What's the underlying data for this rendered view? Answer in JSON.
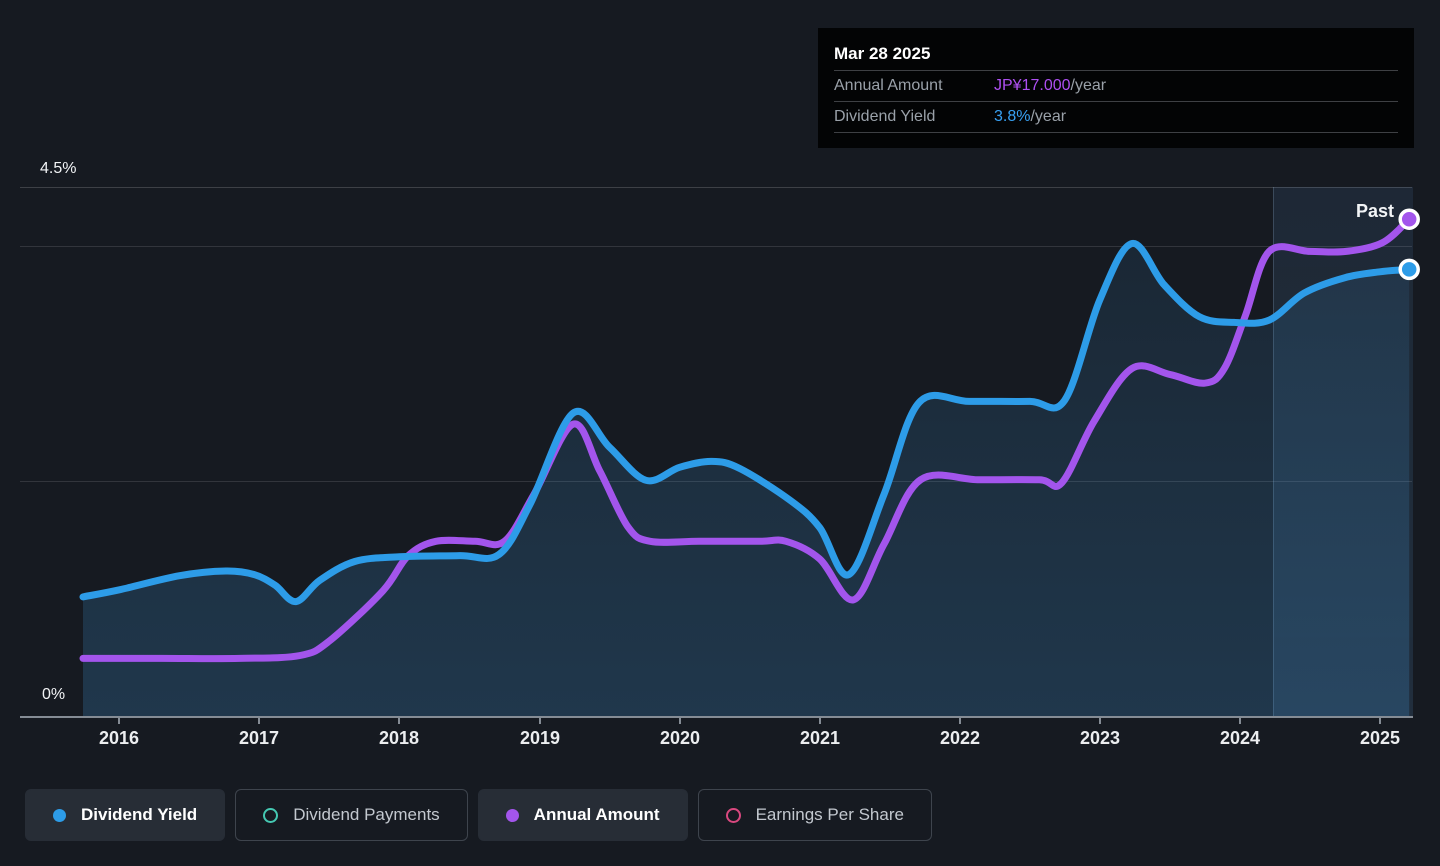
{
  "tooltip": {
    "date": "Mar 28 2025",
    "rows": [
      {
        "label": "Annual Amount",
        "value": "JP¥17.000",
        "suffix": "/year",
        "color": "#ae4ff2"
      },
      {
        "label": "Dividend Yield",
        "value": "3.8%",
        "suffix": "/year",
        "color": "#38a0f2"
      }
    ]
  },
  "chart": {
    "y_top_label": "4.5%",
    "y_bottom_label": "0%",
    "past_label": "Past",
    "x_ticks": [
      "2016",
      "2017",
      "2018",
      "2019",
      "2020",
      "2021",
      "2022",
      "2023",
      "2024",
      "2025"
    ]
  },
  "legend": [
    {
      "label": "Dividend Yield",
      "marker": "filled",
      "color": "#2d9ce8",
      "active": true
    },
    {
      "label": "Dividend Payments",
      "marker": "ring",
      "color": "#45c8b2",
      "active": false
    },
    {
      "label": "Annual Amount",
      "marker": "filled",
      "color": "#a355ec",
      "active": true
    },
    {
      "label": "Earnings Per Share",
      "marker": "ring",
      "color": "#d9487f",
      "active": false
    }
  ],
  "chart_data": {
    "type": "line",
    "x_range": [
      2015.74,
      2025.23
    ],
    "x_tick_years": [
      2016,
      2017,
      2018,
      2019,
      2020,
      2021,
      2022,
      2023,
      2024,
      2025
    ],
    "y_axis_percent": {
      "range": [
        0,
        4.5
      ],
      "labeled_ticks": [
        "4.5%",
        "0%"
      ]
    },
    "y_axis_amount_range": [
      0,
      18.1
    ],
    "gridlines_percent": [
      4.5,
      4.0,
      2.0
    ],
    "past_band_start_year": 2024.24,
    "legend_position": "bottom",
    "grid": true,
    "series": [
      {
        "name": "Dividend Yield",
        "unit": "%",
        "axis": "percent",
        "color": "#2d9ce8",
        "end_value_label": "3.8%/year",
        "points": [
          [
            2015.74,
            1.02
          ],
          [
            2016.0,
            1.08
          ],
          [
            2016.43,
            1.2
          ],
          [
            2016.76,
            1.24
          ],
          [
            2016.96,
            1.21
          ],
          [
            2017.11,
            1.12
          ],
          [
            2017.26,
            0.98
          ],
          [
            2017.43,
            1.16
          ],
          [
            2017.68,
            1.32
          ],
          [
            2018.0,
            1.36
          ],
          [
            2018.43,
            1.37
          ],
          [
            2018.71,
            1.38
          ],
          [
            2018.93,
            1.8
          ],
          [
            2019.24,
            2.58
          ],
          [
            2019.5,
            2.29
          ],
          [
            2019.76,
            2.01
          ],
          [
            2020.0,
            2.12
          ],
          [
            2020.23,
            2.17
          ],
          [
            2020.43,
            2.11
          ],
          [
            2020.79,
            1.84
          ],
          [
            2021.0,
            1.61
          ],
          [
            2021.21,
            1.21
          ],
          [
            2021.46,
            1.89
          ],
          [
            2021.71,
            2.67
          ],
          [
            2022.07,
            2.68
          ],
          [
            2022.5,
            2.68
          ],
          [
            2022.75,
            2.69
          ],
          [
            2023.0,
            3.54
          ],
          [
            2023.23,
            4.02
          ],
          [
            2023.46,
            3.67
          ],
          [
            2023.71,
            3.4
          ],
          [
            2023.96,
            3.35
          ],
          [
            2024.21,
            3.37
          ],
          [
            2024.46,
            3.6
          ],
          [
            2024.75,
            3.73
          ],
          [
            2025.0,
            3.78
          ],
          [
            2025.21,
            3.8
          ]
        ]
      },
      {
        "name": "Annual Amount",
        "unit": "JP¥",
        "axis": "amount",
        "color": "#a355ec",
        "end_value_label": "JP¥17.000/year",
        "points": [
          [
            2015.74,
            2.0
          ],
          [
            2016.3,
            2.0
          ],
          [
            2016.86,
            2.0
          ],
          [
            2017.29,
            2.1
          ],
          [
            2017.5,
            2.6
          ],
          [
            2017.88,
            4.3
          ],
          [
            2018.06,
            5.5
          ],
          [
            2018.26,
            6.0
          ],
          [
            2018.54,
            6.0
          ],
          [
            2018.75,
            6.0
          ],
          [
            2018.96,
            7.6
          ],
          [
            2019.24,
            10.0
          ],
          [
            2019.43,
            8.4
          ],
          [
            2019.63,
            6.5
          ],
          [
            2019.79,
            6.0
          ],
          [
            2020.14,
            6.0
          ],
          [
            2020.57,
            6.0
          ],
          [
            2020.76,
            6.0
          ],
          [
            2021.0,
            5.4
          ],
          [
            2021.24,
            4.0
          ],
          [
            2021.46,
            5.9
          ],
          [
            2021.72,
            8.1
          ],
          [
            2022.14,
            8.1
          ],
          [
            2022.57,
            8.1
          ],
          [
            2022.73,
            8.0
          ],
          [
            2022.96,
            10.1
          ],
          [
            2023.23,
            11.9
          ],
          [
            2023.5,
            11.7
          ],
          [
            2023.75,
            11.4
          ],
          [
            2023.89,
            11.9
          ],
          [
            2024.04,
            13.7
          ],
          [
            2024.21,
            15.9
          ],
          [
            2024.5,
            15.9
          ],
          [
            2024.76,
            15.9
          ],
          [
            2025.02,
            16.2
          ],
          [
            2025.21,
            17.0
          ]
        ]
      }
    ]
  }
}
